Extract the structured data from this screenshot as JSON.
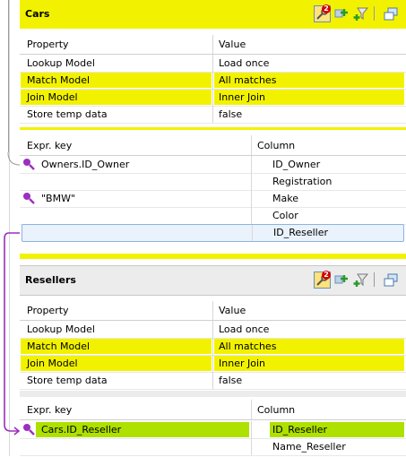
{
  "cars": {
    "title": "Cars",
    "badge": "2",
    "props_header": {
      "property": "Property",
      "value": "Value"
    },
    "props": [
      {
        "property": "Lookup Model",
        "value": "Load once",
        "highlight": false
      },
      {
        "property": "Match Model",
        "value": "All matches",
        "highlight": true
      },
      {
        "property": "Join Model",
        "value": "Inner Join",
        "highlight": true
      },
      {
        "property": "Store temp data",
        "value": "false",
        "highlight": false
      }
    ],
    "expr_header": {
      "key": "Expr. key",
      "column": "Column"
    },
    "rows": [
      {
        "key": "Owners.ID_Owner",
        "column": "ID_Owner",
        "has_key": true
      },
      {
        "key": "",
        "column": "Registration",
        "has_key": false
      },
      {
        "key": "\"BMW\"",
        "column": "Make",
        "has_key": true
      },
      {
        "key": "",
        "column": "Color",
        "has_key": false
      },
      {
        "key": "",
        "column": "ID_Reseller",
        "has_key": false,
        "selected": true
      }
    ]
  },
  "resellers": {
    "title": "Resellers",
    "badge": "2",
    "props_header": {
      "property": "Property",
      "value": "Value"
    },
    "props": [
      {
        "property": "Lookup Model",
        "value": "Load once",
        "highlight": false
      },
      {
        "property": "Match Model",
        "value": "All matches",
        "highlight": true
      },
      {
        "property": "Join Model",
        "value": "Inner Join",
        "highlight": true
      },
      {
        "property": "Store temp data",
        "value": "false",
        "highlight": false
      }
    ],
    "expr_header": {
      "key": "Expr. key",
      "column": "Column"
    },
    "rows": [
      {
        "key": "Cars.ID_Reseller",
        "column": "ID_Reseller",
        "has_key": true,
        "green": true
      },
      {
        "key": "",
        "column": "Name_Reseller",
        "has_key": false
      }
    ]
  },
  "colors": {
    "highlight_yellow": "#f2f200",
    "match_green": "#aee000",
    "link_purple": "#9b2fc0",
    "selection_blue": "#eaf2fc"
  },
  "icons": [
    "settings-icon",
    "add-icon",
    "add-filter-icon",
    "minimize-icon"
  ]
}
